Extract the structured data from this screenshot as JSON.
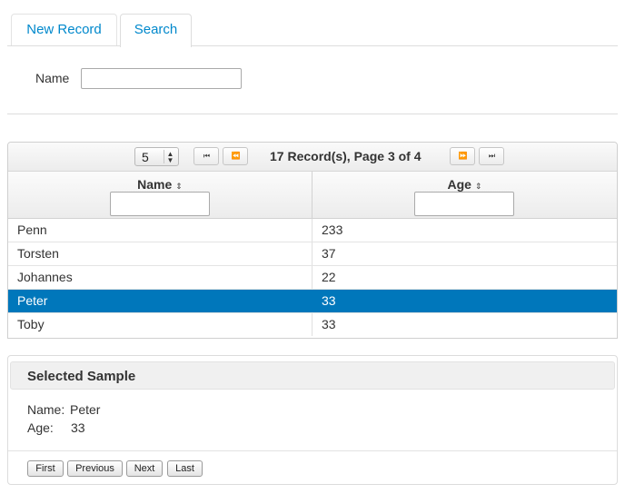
{
  "tabs": [
    {
      "label": "New Record"
    },
    {
      "label": "Search"
    }
  ],
  "filter": {
    "name_label": "Name",
    "name_value": ""
  },
  "paginator": {
    "page_size": "5",
    "info": "17 Record(s), Page 3 of 4",
    "first_icon": "⏮",
    "prev_icon": "⏪",
    "next_icon": "⏩",
    "last_icon": "⏭"
  },
  "table": {
    "columns": [
      "Name",
      "Age"
    ],
    "sort_icon": "⇕",
    "rows": [
      {
        "name": "Penn",
        "age": "233"
      },
      {
        "name": "Torsten",
        "age": "37"
      },
      {
        "name": "Johannes",
        "age": "22"
      },
      {
        "name": "Peter",
        "age": "33"
      },
      {
        "name": "Toby",
        "age": "33"
      }
    ],
    "selected_index": 3
  },
  "selected": {
    "title": "Selected Sample",
    "name_label": "Name:",
    "name_value": "Peter",
    "age_label": "Age:",
    "age_value": "33",
    "buttons": {
      "first": "First",
      "previous": "Previous",
      "next": "Next",
      "last": "Last"
    }
  },
  "colors": {
    "accent": "#0088cc",
    "selected_row": "#0077bb"
  }
}
